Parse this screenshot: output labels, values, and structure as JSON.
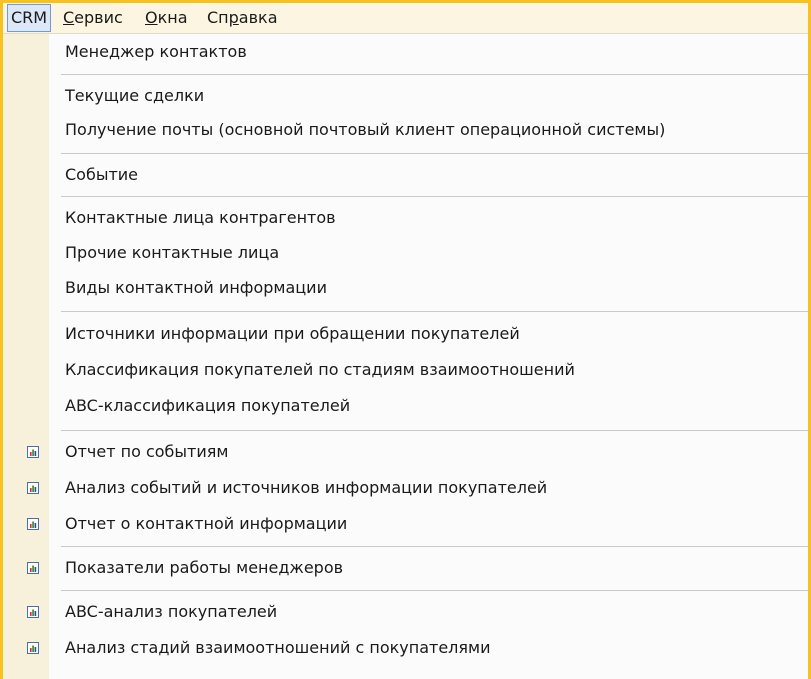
{
  "menubar": {
    "items": [
      {
        "label_plain": "CRM",
        "active": true
      },
      {
        "prefix": "",
        "u": "С",
        "rest": "ервис"
      },
      {
        "prefix": "",
        "u": "О",
        "rest": "кна"
      },
      {
        "prefix": "Сп",
        "u": "р",
        "rest": "авка"
      }
    ]
  },
  "menu": {
    "items": [
      {
        "label": "Менеджер контактов",
        "icon": null
      },
      {
        "label": "Текущие сделки",
        "icon": null
      },
      {
        "label": "Получение почты (основной почтовый клиент операционной системы)",
        "icon": null
      },
      {
        "label": "Событие",
        "icon": null
      },
      {
        "label": "Контактные лица контрагентов",
        "icon": null
      },
      {
        "label": "Прочие контактные лица",
        "icon": null
      },
      {
        "label": "Виды контактной информации",
        "icon": null
      },
      {
        "label": "Источники информации при обращении покупателей",
        "icon": null
      },
      {
        "label": "Классификация покупателей по стадиям взаимоотношений",
        "icon": null
      },
      {
        "label": "ABC-классификация покупателей",
        "icon": null
      },
      {
        "label": "Отчет по событиям",
        "icon": "report-icon"
      },
      {
        "label": "Анализ событий и источников информации покупателей",
        "icon": "report-icon"
      },
      {
        "label": "Отчет о контактной информации",
        "icon": "report-icon"
      },
      {
        "label": "Показатели работы менеджеров",
        "icon": "report-icon"
      },
      {
        "label": "ABC-анализ покупателей",
        "icon": "report-icon"
      },
      {
        "label": "Анализ стадий взаимоотношений с покупателями",
        "icon": "report-icon"
      }
    ]
  },
  "colors": {
    "frame_border": "#f5c220",
    "menubar_bg": "#fbf5e2",
    "active_bg": "#dce8f8",
    "active_border": "#6f9bd6",
    "gutter_bg": "#f7f1dc"
  }
}
